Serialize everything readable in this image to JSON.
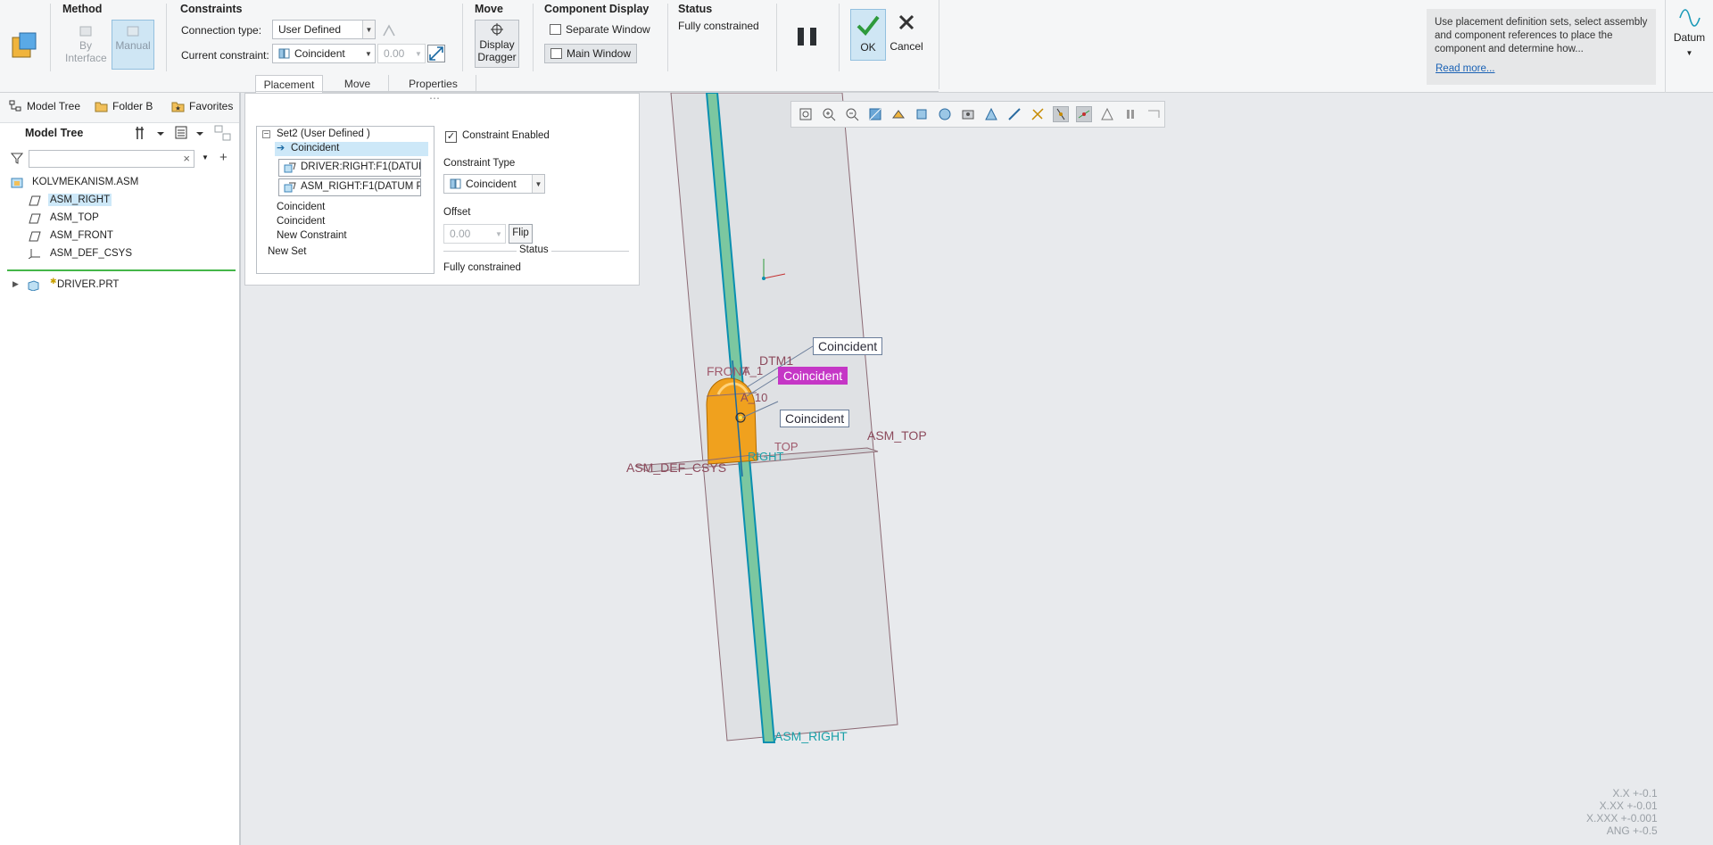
{
  "ribbon": {
    "method": {
      "title": "Method",
      "by_interface": "By Interface",
      "manual": "Manual"
    },
    "constraints": {
      "title": "Constraints",
      "connection_type_label": "Connection type:",
      "connection_type_value": "User Defined",
      "current_constraint_label": "Current constraint:",
      "current_constraint_value": "Coincident",
      "offset_value": "0.00"
    },
    "move": {
      "title": "Move",
      "display_dragger": "Display Dragger"
    },
    "component_display": {
      "title": "Component Display",
      "separate_window": "Separate Window",
      "main_window": "Main Window"
    },
    "status": {
      "title": "Status",
      "value": "Fully constrained"
    },
    "ok": "OK",
    "cancel": "Cancel",
    "tabs": [
      "Placement",
      "Move",
      "Properties"
    ],
    "help_text": "Use placement definition sets, select assembly and component references to place the component and determine how...",
    "read_more": "Read more...",
    "datum": "Datum"
  },
  "left_panel": {
    "tabs": [
      "Model Tree",
      "Folder B",
      "Favorites"
    ],
    "tree_title": "Model Tree",
    "search_placeholder": "",
    "items": [
      "KOLVMEKANISM.ASM",
      "ASM_RIGHT",
      "ASM_TOP",
      "ASM_FRONT",
      "ASM_DEF_CSYS",
      "DRIVER.PRT"
    ]
  },
  "placement": {
    "set_label": "Set2 (User Defined )",
    "constraint_selected": "Coincident",
    "ref1": "DRIVER:RIGHT:F1(DATUM",
    "ref2": "ASM_RIGHT:F1(DATUM P",
    "constraint2": "Coincident",
    "constraint3": "Coincident",
    "new_constraint": "New Constraint",
    "new_set": "New Set",
    "constraint_enabled": "Constraint Enabled",
    "constraint_type_label": "Constraint Type",
    "constraint_type_value": "Coincident",
    "offset_label": "Offset",
    "offset_value": "0.00",
    "flip": "Flip",
    "status_label": "Status",
    "status_value": "Fully constrained"
  },
  "viewport": {
    "callouts": [
      "Coincident",
      "Coincident",
      "Coincident"
    ],
    "labels": {
      "dtm1": "DTM1",
      "front": "FRONT",
      "a1": "A_1",
      "a10": "A_10",
      "asm_top": "ASM_TOP",
      "asm_right": "ASM_RIGHT",
      "asm_def": "ASM_DEF_CSYS",
      "top_part": "TOP",
      "right_part": "RIGHT"
    },
    "tolerances": [
      "X.X +-0.1",
      "X.XX +-0.01",
      "X.XXX +-0.001",
      "ANG +-0.5"
    ]
  },
  "colors": {
    "accent": "#0a8fb0",
    "selection": "#cde8f8",
    "highlight": "#c536c6",
    "part": "#f0a11e"
  }
}
